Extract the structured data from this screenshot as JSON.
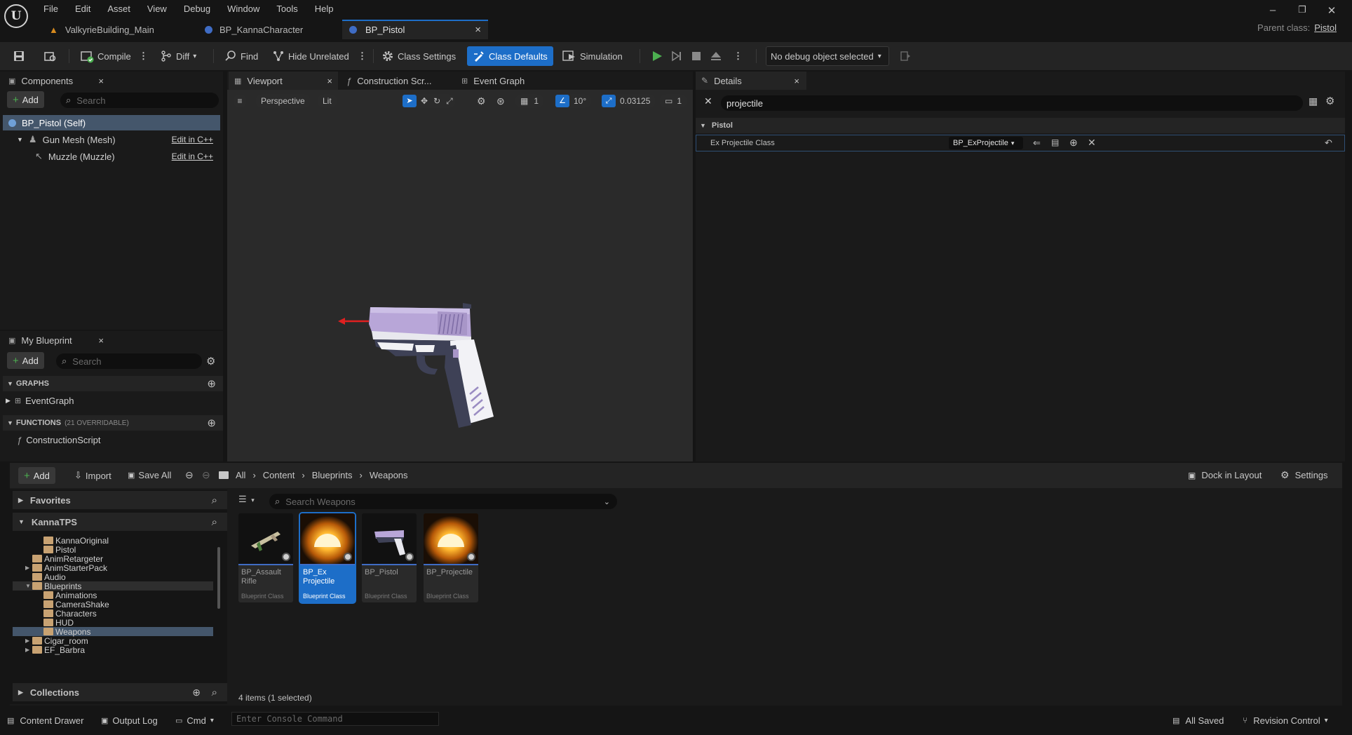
{
  "menu": [
    "File",
    "Edit",
    "Asset",
    "View",
    "Debug",
    "Window",
    "Tools",
    "Help"
  ],
  "doc_tabs": [
    {
      "label": "ValkyrieBuilding_Main"
    },
    {
      "label": "BP_KannaCharacter"
    },
    {
      "label": "BP_Pistol",
      "close": "×"
    }
  ],
  "parent_class": {
    "label": "Parent class:",
    "value": "Pistol"
  },
  "toolbar": {
    "compile": "Compile",
    "diff": "Diff",
    "find": "Find",
    "hide_unrelated": "Hide Unrelated",
    "class_settings": "Class Settings",
    "class_defaults": "Class Defaults",
    "simulation": "Simulation",
    "debug_object": "No debug object selected"
  },
  "components": {
    "tab": "Components",
    "add": "Add",
    "search_placeholder": "Search",
    "items": [
      {
        "label": "BP_Pistol (Self)"
      },
      {
        "label": "Gun Mesh (Mesh)",
        "action": "Edit in C++"
      },
      {
        "label": "Muzzle (Muzzle)",
        "action": "Edit in C++"
      }
    ]
  },
  "my_blueprint": {
    "tab": "My Blueprint",
    "add": "Add",
    "search_placeholder": "Search",
    "graphs": "GRAPHS",
    "event_graph": "EventGraph",
    "functions": "FUNCTIONS",
    "functions_count": "(21 OVERRIDABLE)",
    "construction_script": "ConstructionScript"
  },
  "viewport": {
    "tabs": [
      "Viewport",
      "Construction Scr...",
      "Event Graph"
    ],
    "perspective": "Perspective",
    "lit": "Lit",
    "grid": "1",
    "angle": "10°",
    "scale": "0.03125",
    "camera": "1"
  },
  "details": {
    "tab": "Details",
    "search_value": "projectile",
    "category": "Pistol",
    "property": "Ex Projectile Class",
    "property_value": "BP_ExProjectile"
  },
  "content_browser": {
    "add": "Add",
    "import": "Import",
    "save_all": "Save All",
    "path": [
      "All",
      "Content",
      "Blueprints",
      "Weapons"
    ],
    "dock": "Dock in Layout",
    "settings": "Settings",
    "favorites": "Favorites",
    "project": "KannaTPS",
    "collections": "Collections",
    "search_placeholder": "Search Weapons",
    "tree": [
      {
        "label": "KannaOriginal",
        "depth": 2
      },
      {
        "label": "Pistol",
        "depth": 2
      },
      {
        "label": "AnimRetargeter",
        "depth": 1
      },
      {
        "label": "AnimStarterPack",
        "depth": 1,
        "expander": "▶"
      },
      {
        "label": "Audio",
        "depth": 1
      },
      {
        "label": "Blueprints",
        "depth": 1,
        "expander": "▼",
        "open": true
      },
      {
        "label": "Animations",
        "depth": 2
      },
      {
        "label": "CameraShake",
        "depth": 2
      },
      {
        "label": "Characters",
        "depth": 2
      },
      {
        "label": "HUD",
        "depth": 2
      },
      {
        "label": "Weapons",
        "depth": 2,
        "selected": true
      },
      {
        "label": "Cigar_room",
        "depth": 1,
        "expander": "▶"
      },
      {
        "label": "EF_Barbra",
        "depth": 1,
        "expander": "▶"
      }
    ],
    "assets": [
      {
        "name": "BP_Assault Rifle",
        "class": "Blueprint Class",
        "thumb": "rifle"
      },
      {
        "name": "BP_Ex Projectile",
        "class": "Blueprint Class",
        "thumb": "sun",
        "selected": true
      },
      {
        "name": "BP_Pistol",
        "class": "Blueprint Class",
        "thumb": "pistol"
      },
      {
        "name": "BP_Projectile",
        "class": "Blueprint Class",
        "thumb": "sun"
      }
    ],
    "count": "4 items (1 selected)"
  },
  "status": {
    "content_drawer": "Content Drawer",
    "output_log": "Output Log",
    "cmd": "Cmd",
    "console_placeholder": "Enter Console Command",
    "all_saved": "All Saved",
    "revision_control": "Revision Control"
  },
  "colors": {
    "accent": "#1d6ec8",
    "play": "#4caf50",
    "folder": "#c8a272"
  }
}
